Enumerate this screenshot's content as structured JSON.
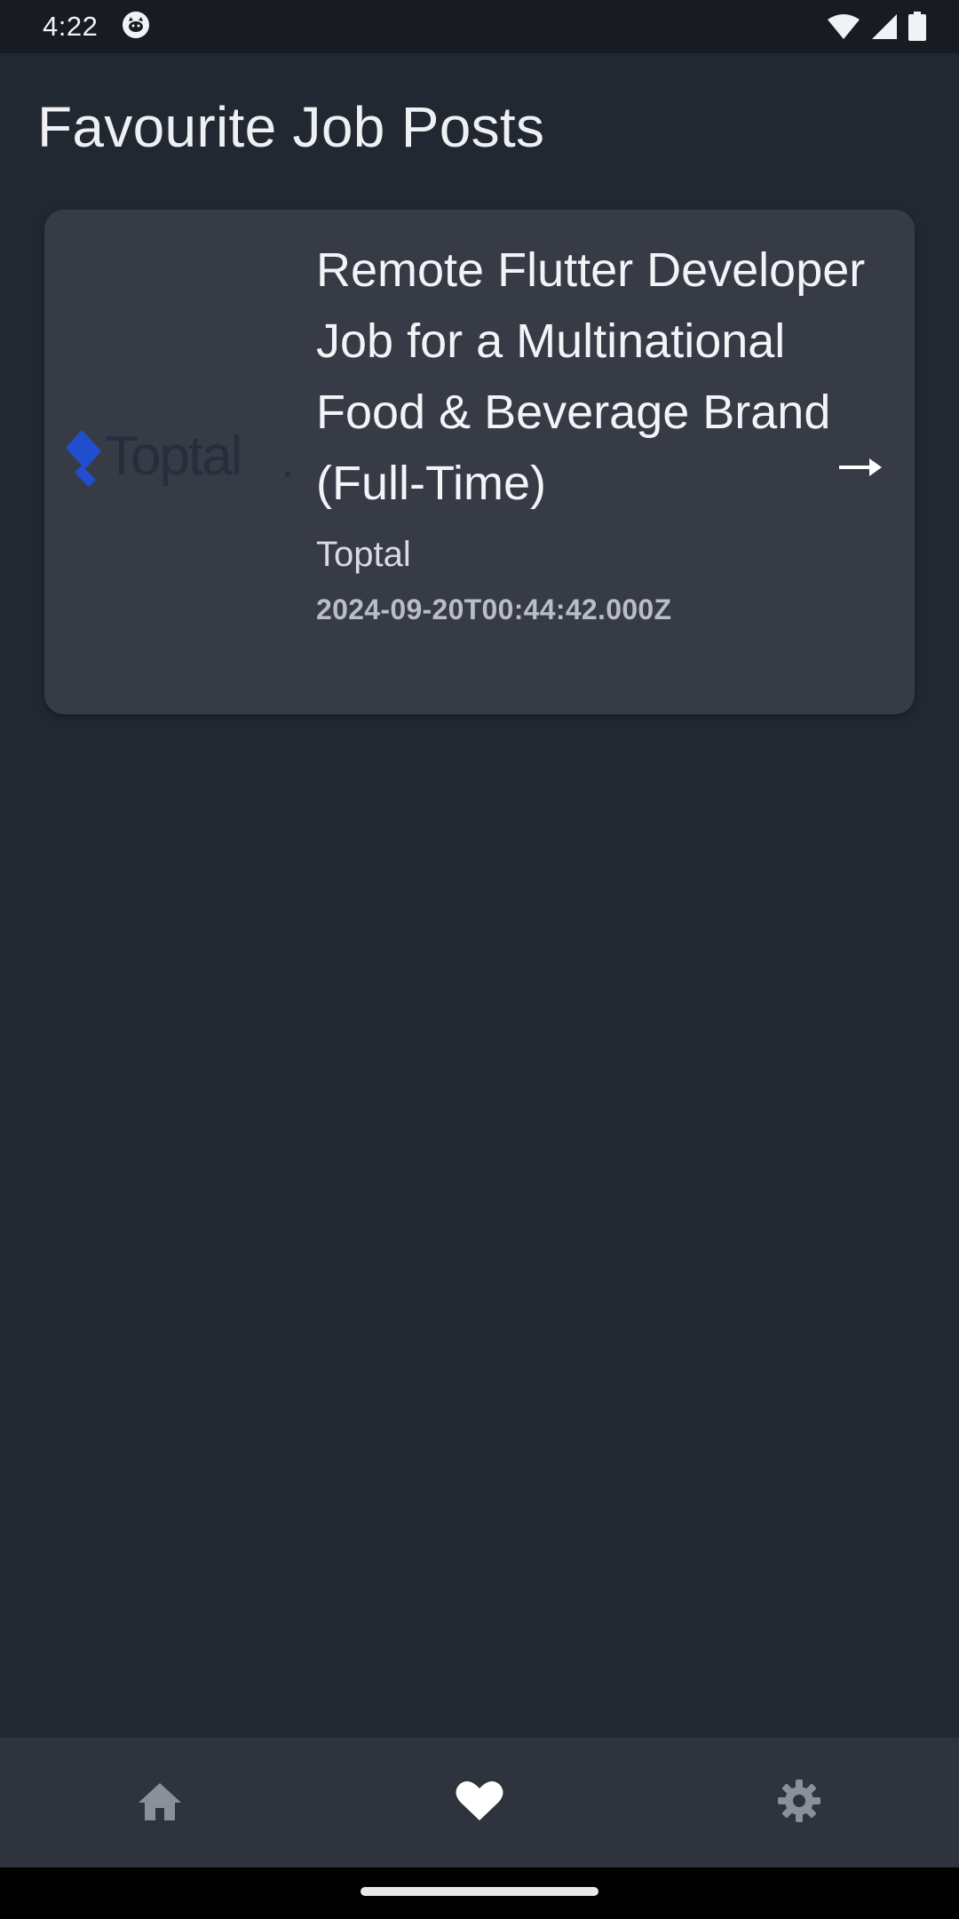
{
  "status_bar": {
    "time": "4:22",
    "icons": [
      "cat-notification-icon",
      "wifi-icon",
      "signal-icon",
      "battery-icon"
    ]
  },
  "page": {
    "title": "Favourite Job Posts"
  },
  "favourites": [
    {
      "logo_text": "Toptal",
      "logo_color": "#204ECF",
      "title": "Remote Flutter Developer Job for a Multinational Food & Beverage Brand (Full-Time)",
      "company": "Toptal",
      "date": "2024-09-20T00:44:42.000Z",
      "action_icon": "arrow-right-icon"
    }
  ],
  "bottom_nav": {
    "items": [
      {
        "icon": "home-icon",
        "active": false
      },
      {
        "icon": "heart-icon",
        "active": true
      },
      {
        "icon": "gear-icon",
        "active": false
      }
    ],
    "active_color": "#ffffff",
    "inactive_color": "#8a8f9a"
  }
}
